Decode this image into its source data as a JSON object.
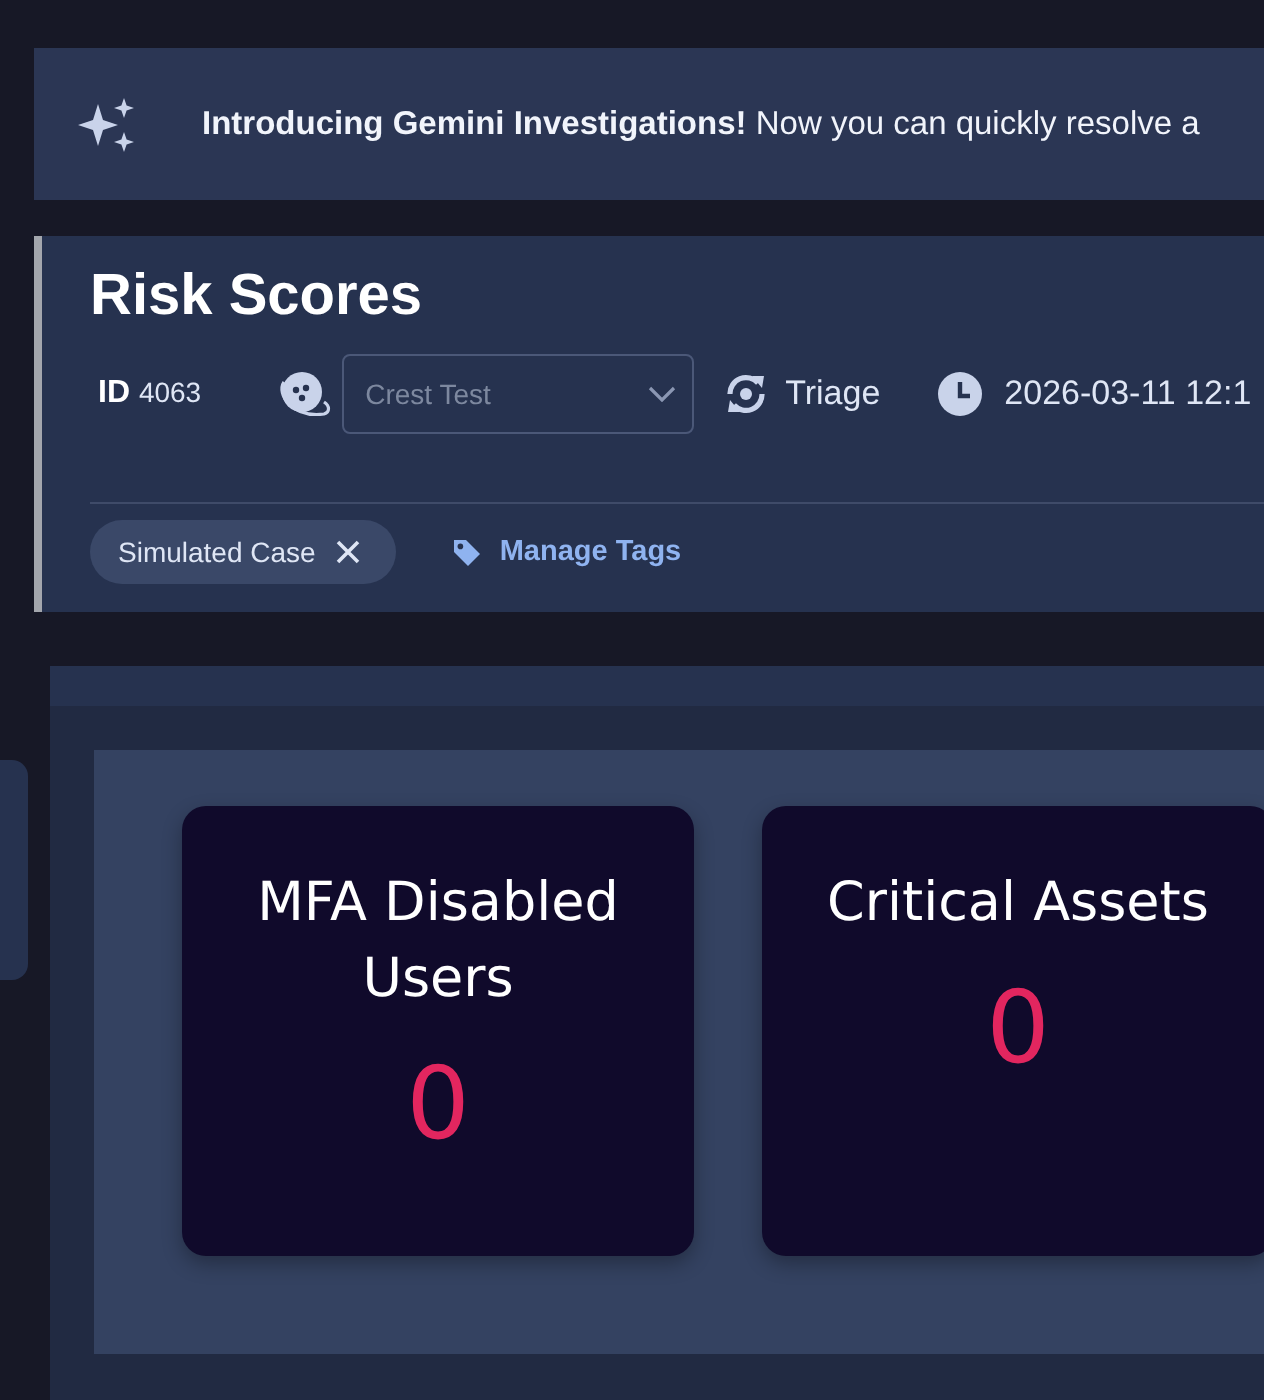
{
  "banner": {
    "text": "**Introducing Gemini Investigations!** Now you can quickly resolve a"
  },
  "case": {
    "title": "Risk Scores",
    "id_label": "ID",
    "id": "4063",
    "assignee": {
      "value": "Crest Test"
    },
    "stage": "Triage",
    "time": "2026-03-11 12:1",
    "tags": [
      {
        "label": "Simulated Case"
      }
    ],
    "manage_tags": "Manage Tags"
  },
  "widgets": [
    {
      "title": "MFA Disabled Users",
      "value": "0"
    },
    {
      "title": "Critical Assets",
      "value": "0"
    }
  ]
}
